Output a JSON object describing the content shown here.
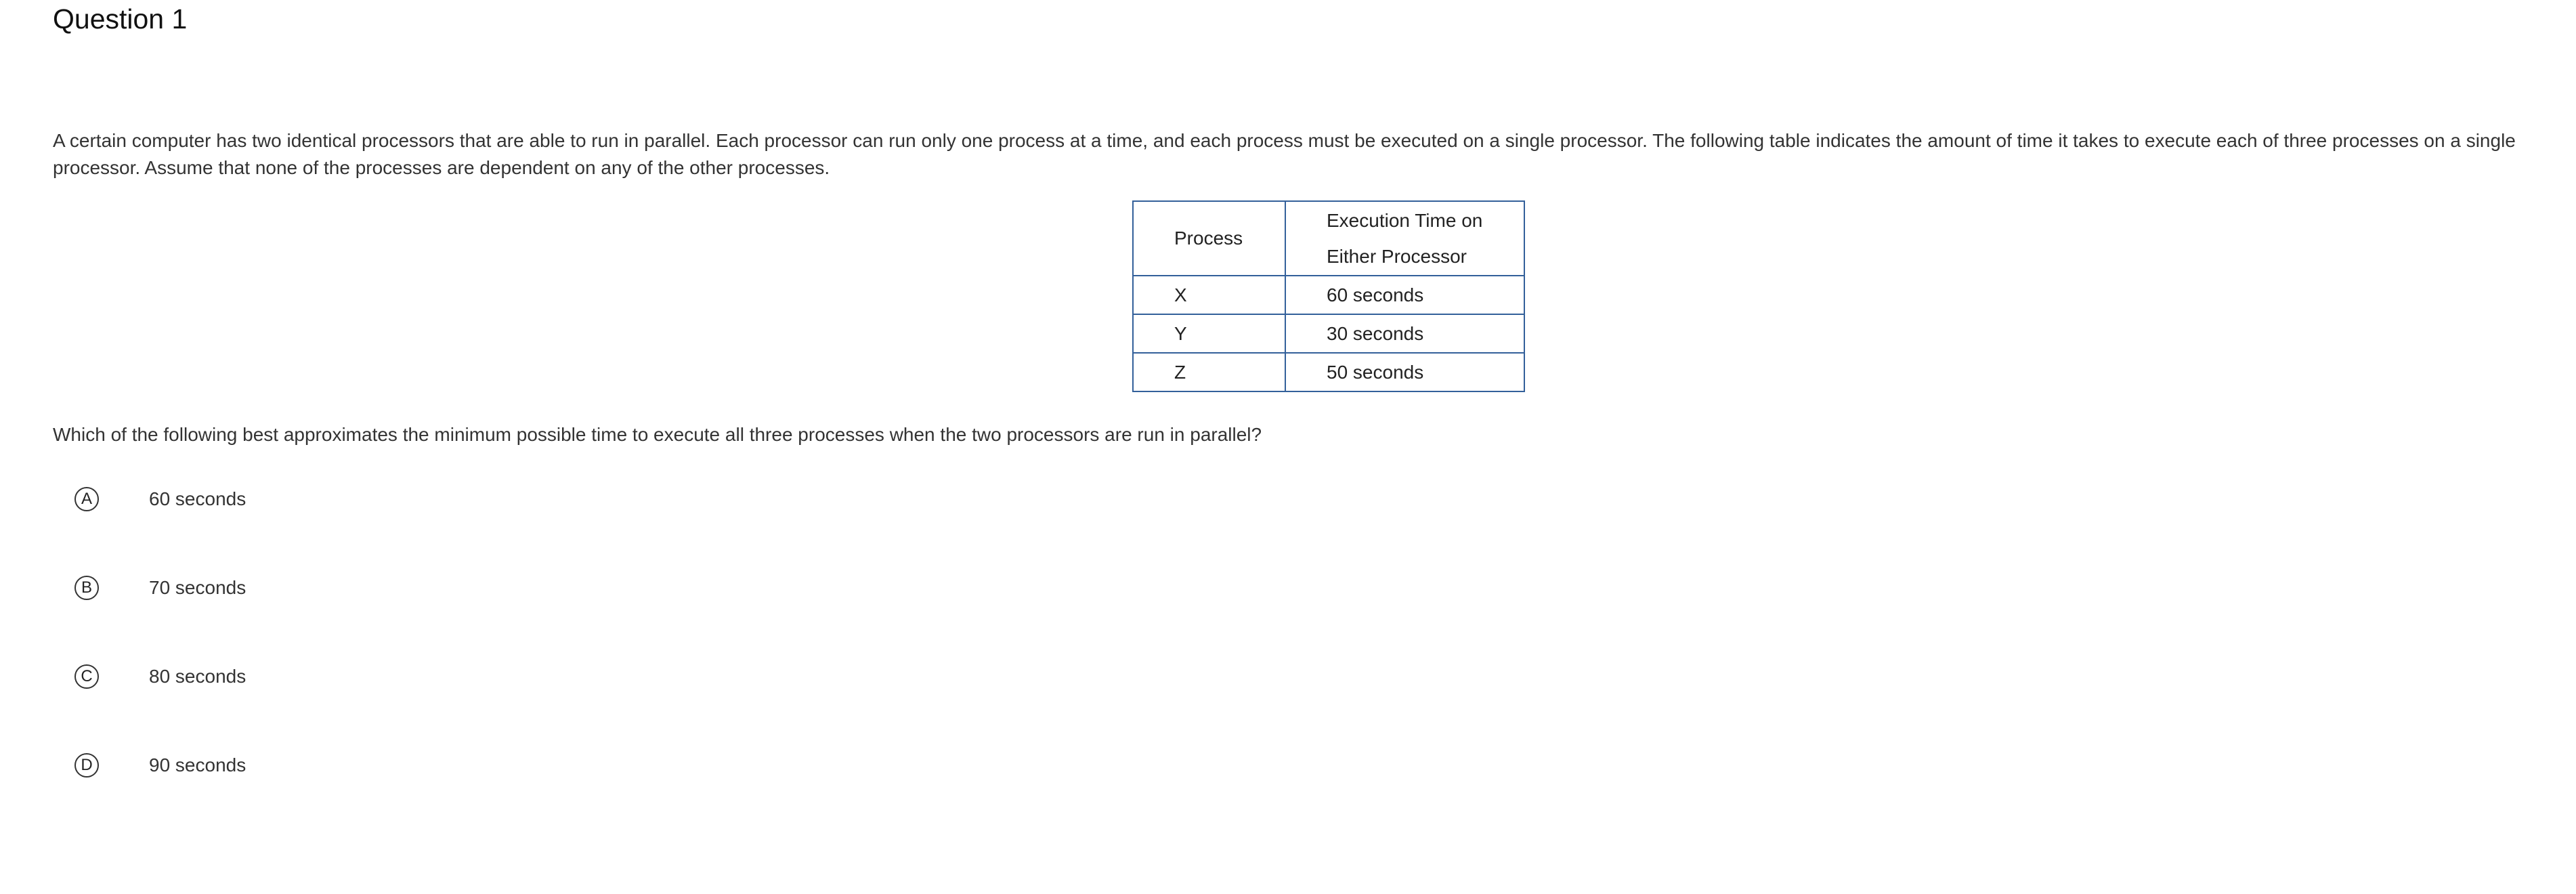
{
  "question": {
    "title": "Question 1",
    "stem": "A certain computer has two identical processors that are able to run in parallel. Each processor can run only one process at a time, and each process must be executed on a single processor. The following table indicates the amount of time it takes to execute each of three processes on a single processor. Assume that none of the processes are dependent on any of the other processes.",
    "table": {
      "headers": [
        "Process",
        "Execution Time on",
        "Either Processor"
      ],
      "rows": [
        {
          "process": "X",
          "time": "60 seconds"
        },
        {
          "process": "Y",
          "time": "30 seconds"
        },
        {
          "process": "Z",
          "time": "50 seconds"
        }
      ]
    },
    "prompt": "Which of the following best approximates the minimum possible time to execute all three processes when the two processors are run in parallel?",
    "choices": [
      {
        "letter": "A",
        "text": "60 seconds"
      },
      {
        "letter": "B",
        "text": "70 seconds"
      },
      {
        "letter": "C",
        "text": "80 seconds"
      },
      {
        "letter": "D",
        "text": "90 seconds"
      }
    ]
  },
  "colors": {
    "table_border": "#33609a",
    "text": "#333333"
  }
}
